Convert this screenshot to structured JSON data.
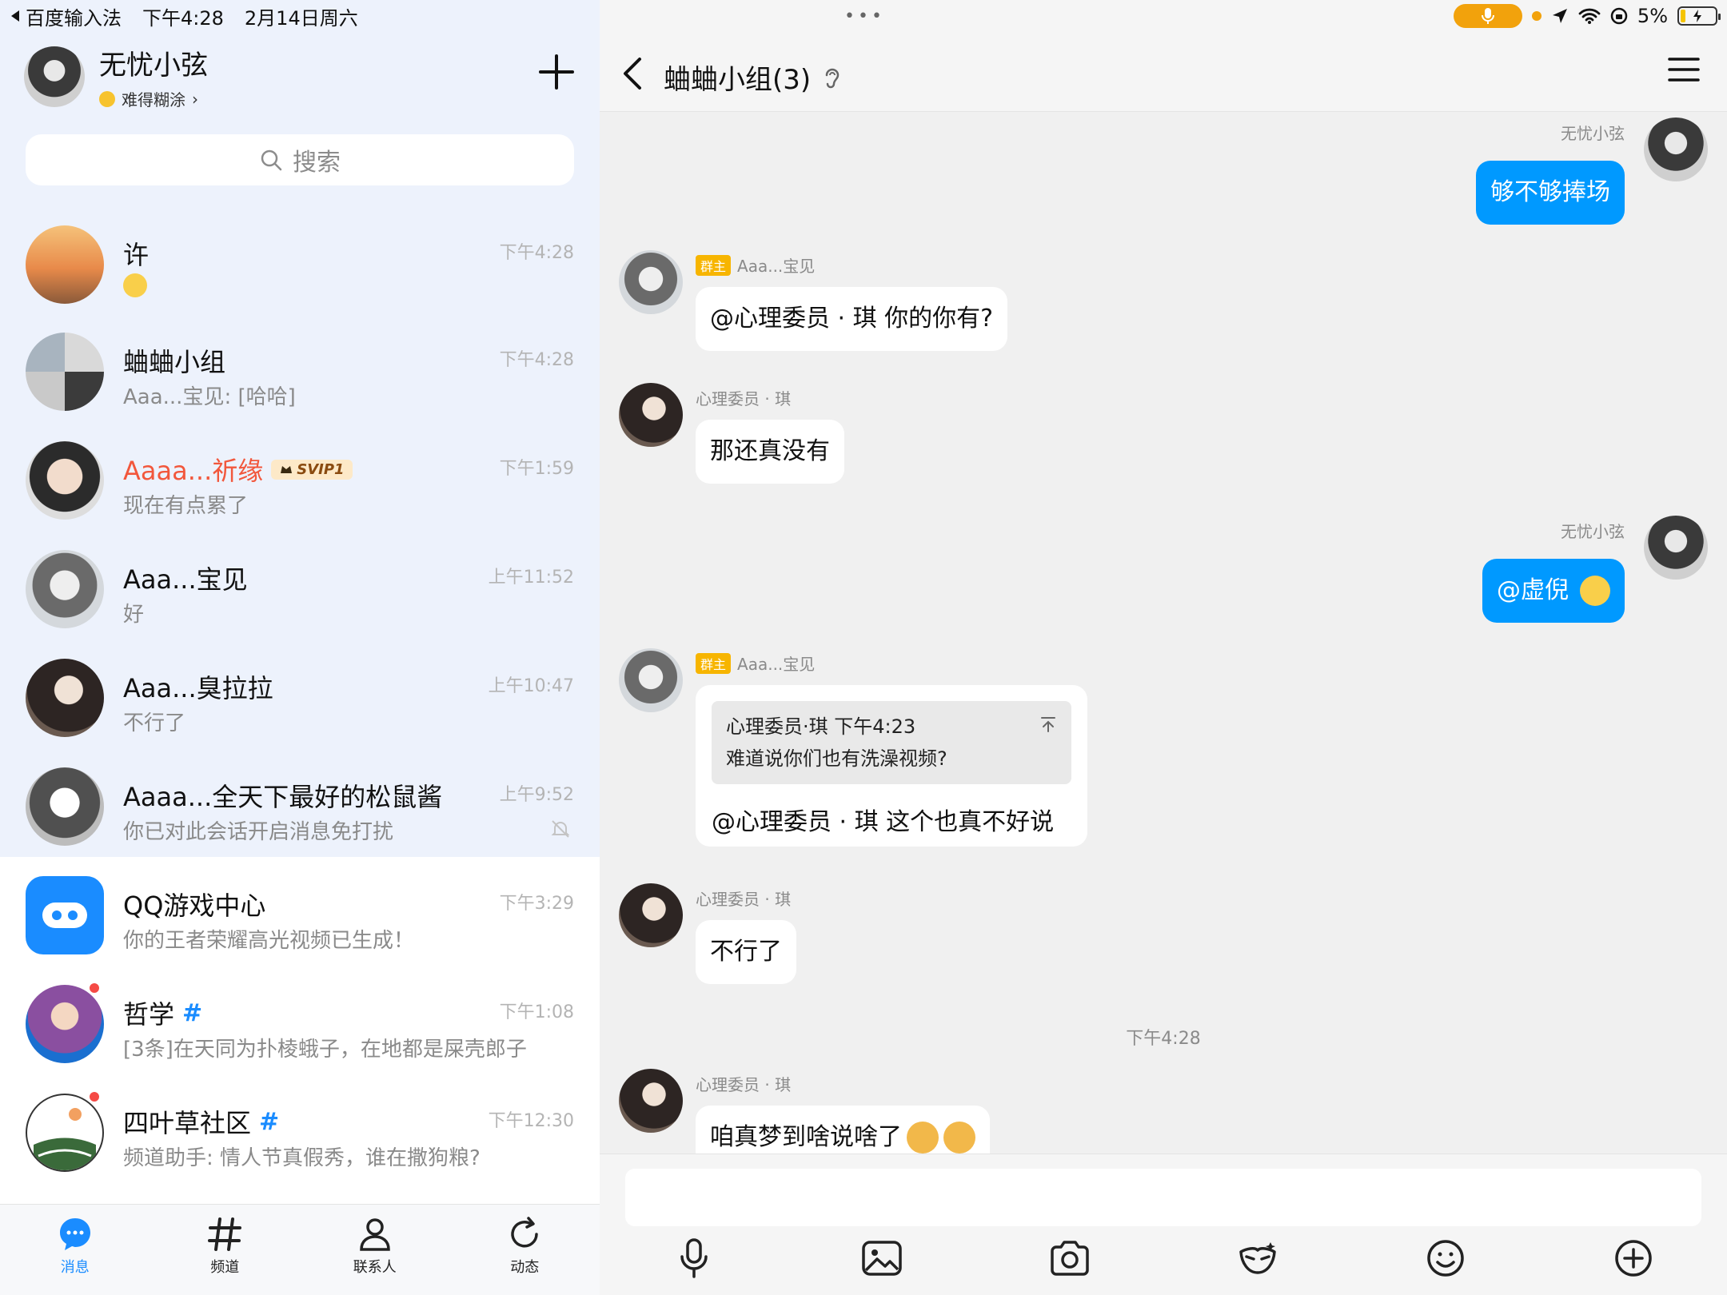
{
  "status_bar": {
    "back_app": "百度输入法",
    "time": "下午4:28",
    "date": "2月14日周六",
    "dots": "•••",
    "battery": "5%"
  },
  "profile": {
    "name": "无忧小弦",
    "status": "难得糊涂",
    "status_chevron": "›"
  },
  "search": {
    "placeholder": "搜索"
  },
  "conversations": [
    {
      "name": "许",
      "preview": "",
      "time": "下午4:28"
    },
    {
      "name": "蛐蛐小组",
      "preview": "Aaa...宝见: [哈哈]",
      "time": "下午4:28"
    },
    {
      "name": "Aaaa...祈缘",
      "badge": "SVIP1",
      "preview": "现在有点累了",
      "time": "下午1:59"
    },
    {
      "name": "Aaa...宝见",
      "preview": "好",
      "time": "上午11:52"
    },
    {
      "name": "Aaa...臭拉拉",
      "preview": "不行了",
      "time": "上午10:47"
    },
    {
      "name": "Aaaa...全天下最好的松鼠酱",
      "preview": "你已对此会话开启消息免打扰",
      "time": "上午9:52"
    },
    {
      "name": "QQ游戏中心",
      "preview": "你的王者荣耀高光视频已生成！",
      "time": "下午3:29"
    },
    {
      "name": "哲学",
      "tag": "#",
      "preview": "[3条]在天同为扑棱蛾子，在地都是屎壳郎子",
      "time": "下午1:08"
    },
    {
      "name": "四叶草社区",
      "tag": "#",
      "preview": "频道助手: 情人节真假秀，谁在撒狗粮?",
      "time": "下午12:30"
    }
  ],
  "tabs": [
    {
      "label": "消息"
    },
    {
      "label": "频道"
    },
    {
      "label": "联系人"
    },
    {
      "label": "动态"
    }
  ],
  "chat": {
    "title": "蛐蛐小组(3)",
    "owner_badge": "群主",
    "messages": [
      {
        "sender": "无忧小弦",
        "text": "够不够捧场"
      },
      {
        "sender": "Aaa...宝见",
        "text": "@心理委员 · 琪 你的你有?"
      },
      {
        "sender": "心理委员 · 琪",
        "text": "那还真没有"
      },
      {
        "sender": "无忧小弦",
        "text": "@虚倪"
      },
      {
        "sender": "Aaa...宝见",
        "quote_header": "心理委员·琪 下午4:23",
        "quote_text": "难道说你们也有洗澡视频?",
        "text": "@心理委员 · 琪 这个也真不好说"
      },
      {
        "sender": "心理委员 · 琪",
        "text": "不行了"
      },
      {
        "sender": "心理委员 · 琪",
        "text": "咱真梦到啥说啥了"
      }
    ],
    "time_separator": "下午4:28"
  },
  "colors": {
    "accent": "#0099ff",
    "left_bg": "#edf2fc",
    "red_name": "#f2573c",
    "owner_badge": "#f7b500"
  }
}
